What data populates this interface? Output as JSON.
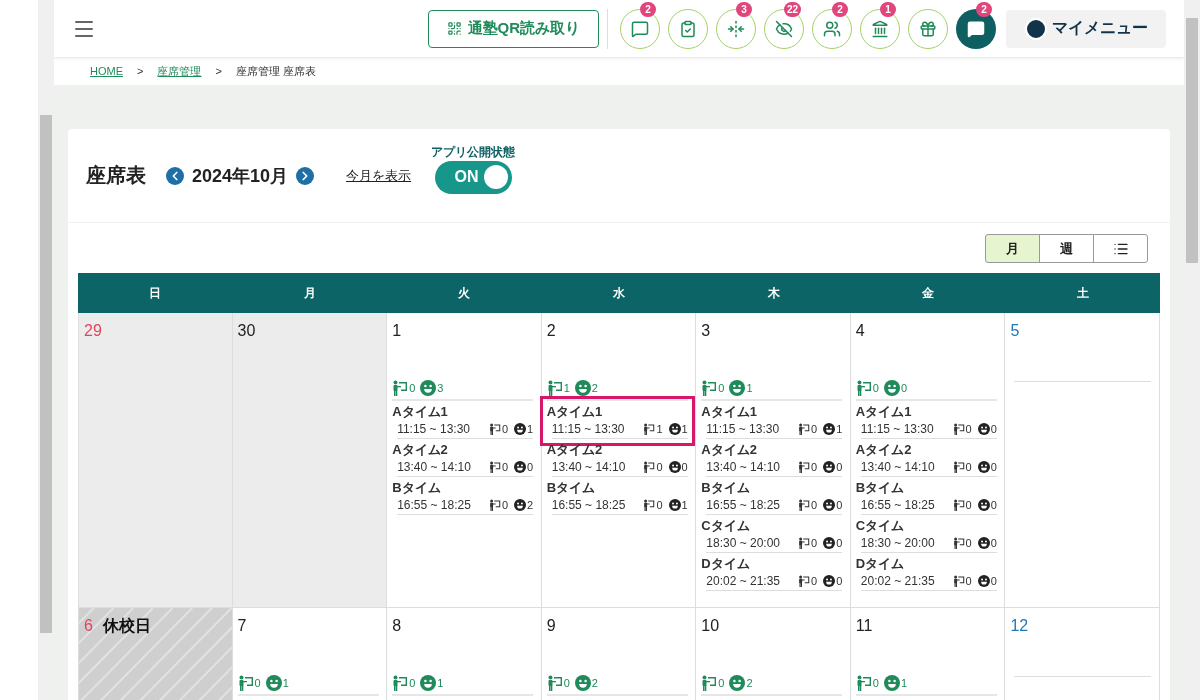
{
  "header": {
    "qr_button": "通塾QR読み取り",
    "icon_buttons": [
      {
        "kind": "chat",
        "badge": "2",
        "filled": false
      },
      {
        "kind": "checklist",
        "filled": false
      },
      {
        "kind": "arrows",
        "badge": "3",
        "filled": false
      },
      {
        "kind": "eyeoff",
        "badge": "22",
        "filled": false
      },
      {
        "kind": "group",
        "badge": "2",
        "filled": false
      },
      {
        "kind": "bank",
        "badge": "1",
        "filled": false
      },
      {
        "kind": "gift",
        "filled": false
      },
      {
        "kind": "chat",
        "badge": "2",
        "filled": true
      }
    ],
    "my_menu": "マイメニュー"
  },
  "breadcrumb": [
    {
      "label": "HOME",
      "link": true
    },
    {
      "label": "座席管理",
      "link": true
    },
    {
      "label": "座席管理 座席表",
      "link": false
    }
  ],
  "breadcrumb_separator": ">",
  "page": {
    "title": "座席表",
    "month": "2024年10月",
    "today_link": "今月を表示",
    "publish": {
      "label": "アプリ公開状態",
      "on": true,
      "text": "ON"
    }
  },
  "views": [
    {
      "kind": "text",
      "label": "月",
      "selected": true
    },
    {
      "kind": "text",
      "label": "週",
      "selected": false
    },
    {
      "kind": "list",
      "selected": false
    }
  ],
  "weekdays": [
    {
      "label": "日"
    },
    {
      "label": "月"
    },
    {
      "label": "火"
    },
    {
      "label": "水"
    },
    {
      "label": "木"
    },
    {
      "label": "金"
    },
    {
      "label": "土"
    }
  ],
  "weeks": [
    [
      {
        "date": "29",
        "kind": "sunday",
        "outside": true,
        "closed": false
      },
      {
        "date": "30",
        "kind": "weekday",
        "outside": true,
        "closed": false
      },
      {
        "date": "1",
        "kind": "weekday",
        "outside": false,
        "closed": false,
        "teachers": "0",
        "students": "3",
        "slots": [
          {
            "name": "Aタイム1",
            "time": "11:15 ~ 13:30",
            "teachers": "0",
            "students": "1",
            "highlighted": false
          },
          {
            "name": "Aタイム2",
            "time": "13:40 ~ 14:10",
            "teachers": "0",
            "students": "0",
            "highlighted": false
          },
          {
            "name": "Bタイム",
            "time": "16:55 ~ 18:25",
            "teachers": "0",
            "students": "2",
            "highlighted": false
          }
        ]
      },
      {
        "date": "2",
        "kind": "weekday",
        "outside": false,
        "closed": false,
        "teachers": "1",
        "students": "2",
        "slots": [
          {
            "name": "Aタイム1",
            "time": "11:15 ~ 13:30",
            "teachers": "1",
            "students": "1",
            "highlighted": true
          },
          {
            "name": "Aタイム2",
            "time": "13:40 ~ 14:10",
            "teachers": "0",
            "students": "0",
            "highlighted": false
          },
          {
            "name": "Bタイム",
            "time": "16:55 ~ 18:25",
            "teachers": "0",
            "students": "1",
            "highlighted": false
          }
        ]
      },
      {
        "date": "3",
        "kind": "weekday",
        "outside": false,
        "closed": false,
        "teachers": "0",
        "students": "1",
        "slots": [
          {
            "name": "Aタイム1",
            "time": "11:15 ~ 13:30",
            "teachers": "0",
            "students": "1",
            "highlighted": false
          },
          {
            "name": "Aタイム2",
            "time": "13:40 ~ 14:10",
            "teachers": "0",
            "students": "0",
            "highlighted": false
          },
          {
            "name": "Bタイム",
            "time": "16:55 ~ 18:25",
            "teachers": "0",
            "students": "0",
            "highlighted": false
          },
          {
            "name": "Cタイム",
            "time": "18:30 ~ 20:00",
            "teachers": "0",
            "students": "0",
            "highlighted": false
          },
          {
            "name": "Dタイム",
            "time": "20:02 ~ 21:35",
            "teachers": "0",
            "students": "0",
            "highlighted": false
          }
        ]
      },
      {
        "date": "4",
        "kind": "weekday",
        "outside": false,
        "closed": false,
        "teachers": "0",
        "students": "0",
        "slots": [
          {
            "name": "Aタイム1",
            "time": "11:15 ~ 13:30",
            "teachers": "0",
            "students": "0",
            "highlighted": false
          },
          {
            "name": "Aタイム2",
            "time": "13:40 ~ 14:10",
            "teachers": "0",
            "students": "0",
            "highlighted": false
          },
          {
            "name": "Bタイム",
            "time": "16:55 ~ 18:25",
            "teachers": "0",
            "students": "0",
            "highlighted": false
          },
          {
            "name": "Cタイム",
            "time": "18:30 ~ 20:00",
            "teachers": "0",
            "students": "0",
            "highlighted": false
          },
          {
            "name": "Dタイム",
            "time": "20:02 ~ 21:35",
            "teachers": "0",
            "students": "0",
            "highlighted": false
          }
        ]
      },
      {
        "date": "5",
        "kind": "saturday",
        "outside": false,
        "closed": false
      }
    ],
    [
      {
        "date": "6",
        "kind": "sunday",
        "outside": false,
        "closed": true,
        "closed_label": "休校日"
      },
      {
        "date": "7",
        "kind": "weekday",
        "outside": false,
        "closed": false,
        "teachers": "0",
        "students": "1"
      },
      {
        "date": "8",
        "kind": "weekday",
        "outside": false,
        "closed": false,
        "teachers": "0",
        "students": "1"
      },
      {
        "date": "9",
        "kind": "weekday",
        "outside": false,
        "closed": false,
        "teachers": "0",
        "students": "2"
      },
      {
        "date": "10",
        "kind": "weekday",
        "outside": false,
        "closed": false,
        "teachers": "0",
        "students": "2"
      },
      {
        "date": "11",
        "kind": "weekday",
        "outside": false,
        "closed": false,
        "teachers": "0",
        "students": "1"
      },
      {
        "date": "12",
        "kind": "saturday",
        "outside": false,
        "closed": false
      }
    ]
  ]
}
